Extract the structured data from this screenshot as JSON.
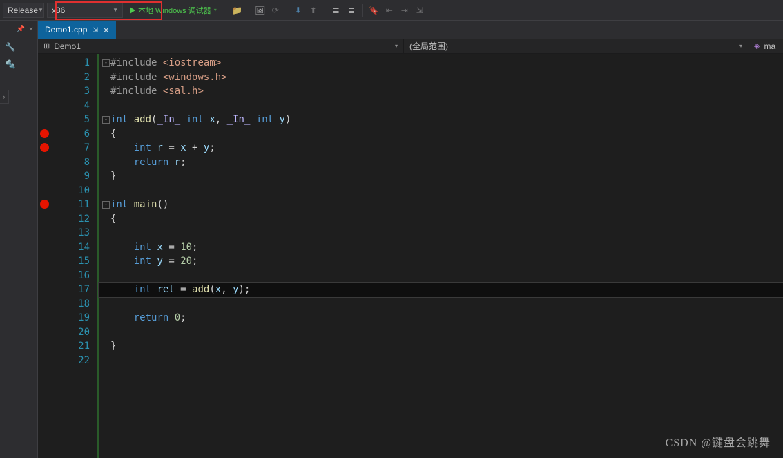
{
  "toolbar": {
    "config": "Release",
    "platform": "x86",
    "debug_label": "本地 Windows 调试器"
  },
  "tab": {
    "filename": "Demo1.cpp"
  },
  "navbar": {
    "project": "Demo1",
    "scope": "(全局范围)",
    "member": "ma"
  },
  "editor": {
    "line_count": 22,
    "breakpoints": [
      6,
      7,
      11
    ],
    "fold_points": [
      1,
      5,
      11
    ],
    "current_line": 17,
    "lines": [
      {
        "n": 1,
        "t": "pp",
        "raw": "#include <iostream>"
      },
      {
        "n": 2,
        "t": "pp",
        "raw": "#include <windows.h>"
      },
      {
        "n": 3,
        "t": "pp",
        "raw": "#include <sal.h>"
      },
      {
        "n": 4,
        "t": "",
        "raw": ""
      },
      {
        "n": 5,
        "t": "f",
        "raw": "int add(_In_ int x, _In_ int y)"
      },
      {
        "n": 6,
        "t": "",
        "raw": "{"
      },
      {
        "n": 7,
        "t": "",
        "raw": "    int r = x + y;"
      },
      {
        "n": 8,
        "t": "",
        "raw": "    return r;"
      },
      {
        "n": 9,
        "t": "",
        "raw": "}"
      },
      {
        "n": 10,
        "t": "",
        "raw": ""
      },
      {
        "n": 11,
        "t": "f",
        "raw": "int main()"
      },
      {
        "n": 12,
        "t": "",
        "raw": "{"
      },
      {
        "n": 13,
        "t": "",
        "raw": ""
      },
      {
        "n": 14,
        "t": "",
        "raw": "    int x = 10;"
      },
      {
        "n": 15,
        "t": "",
        "raw": "    int y = 20;"
      },
      {
        "n": 16,
        "t": "",
        "raw": ""
      },
      {
        "n": 17,
        "t": "",
        "raw": "    int ret = add(x, y);"
      },
      {
        "n": 18,
        "t": "",
        "raw": ""
      },
      {
        "n": 19,
        "t": "",
        "raw": "    return 0;"
      },
      {
        "n": 20,
        "t": "",
        "raw": ""
      },
      {
        "n": 21,
        "t": "",
        "raw": "}"
      },
      {
        "n": 22,
        "t": "",
        "raw": ""
      }
    ]
  },
  "watermark": "CSDN @键盘会跳舞",
  "icons": {
    "pin": "📌",
    "wrench": "🔧",
    "gear": "⚙",
    "folder": "📁",
    "image": "🖼"
  }
}
